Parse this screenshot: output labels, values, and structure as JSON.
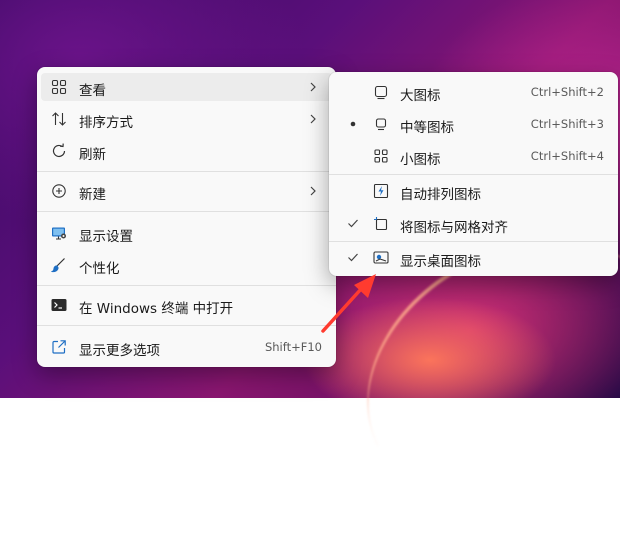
{
  "main_menu": {
    "items": [
      {
        "label": "查看",
        "icon": "grid-icon",
        "has_submenu": true
      },
      {
        "label": "排序方式",
        "icon": "sort-icon",
        "has_submenu": true
      },
      {
        "label": "刷新",
        "icon": "refresh-icon"
      },
      {
        "label": "新建",
        "icon": "plus-circle-icon",
        "has_submenu": true
      },
      {
        "label": "显示设置",
        "icon": "display-settings-icon"
      },
      {
        "label": "个性化",
        "icon": "brush-icon"
      },
      {
        "label": "在 Windows 终端 中打开",
        "icon": "terminal-icon"
      },
      {
        "label": "显示更多选项",
        "icon": "share-icon",
        "shortcut": "Shift+F10"
      }
    ]
  },
  "view_submenu": {
    "items": [
      {
        "label": "大图标",
        "icon": "large-icon-icon",
        "shortcut": "Ctrl+Shift+2",
        "mark": ""
      },
      {
        "label": "中等图标",
        "icon": "medium-icon-icon",
        "shortcut": "Ctrl+Shift+3",
        "mark": "bullet"
      },
      {
        "label": "小图标",
        "icon": "small-icons-icon",
        "shortcut": "Ctrl+Shift+4",
        "mark": ""
      },
      {
        "label": "自动排列图标",
        "icon": "auto-arrange-icon",
        "mark": ""
      },
      {
        "label": "将图标与网格对齐",
        "icon": "align-grid-icon",
        "mark": "check"
      },
      {
        "label": "显示桌面图标",
        "icon": "show-desktop-icons-icon",
        "mark": "check"
      }
    ]
  },
  "colors": {
    "menu_bg": "#f9f9f9",
    "hover_bg": "#ececec",
    "accent": "#0067c0",
    "arrow": "#ff3b2f"
  }
}
